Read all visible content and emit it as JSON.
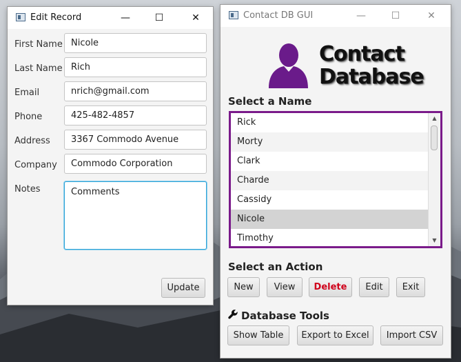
{
  "edit_window": {
    "title": "Edit Record",
    "fields": [
      {
        "label": "First Name",
        "value": "Nicole"
      },
      {
        "label": "Last Name",
        "value": "Rich"
      },
      {
        "label": "Email",
        "value": "nrich@gmail.com"
      },
      {
        "label": "Phone",
        "value": "425-482-4857"
      },
      {
        "label": "Address",
        "value": "3367 Commodo Avenue"
      },
      {
        "label": "Company",
        "value": "Commodo Corporation"
      }
    ],
    "notes_label": "Notes",
    "notes_value": "Comments",
    "update_label": "Update"
  },
  "contact_window": {
    "title": "Contact DB GUI",
    "logo_line1": "Contact",
    "logo_line2": "Database",
    "logo_color": "#6a1b8a",
    "select_name_heading": "Select a Name",
    "names": [
      "Rick",
      "Morty",
      "Clark",
      "Charde",
      "Cassidy",
      "Nicole",
      "Timothy"
    ],
    "selected_name": "Nicole",
    "select_action_heading": "Select an Action",
    "actions": {
      "new": "New",
      "view": "View",
      "delete": "Delete",
      "edit": "Edit",
      "exit": "Exit"
    },
    "tools_heading": "Database Tools",
    "tools": {
      "show_table": "Show Table",
      "export": "Export to Excel",
      "import": "Import CSV"
    }
  },
  "icons": {
    "window_controls": [
      "minimize-icon",
      "maximize-icon",
      "close-icon"
    ],
    "tools_icon": "wrench-icon",
    "logo_icon": "person-silhouette-icon"
  },
  "colors": {
    "list_border": "#7a1a8a",
    "delete_text": "#d0021b",
    "focus_border": "#2ea3d6"
  }
}
